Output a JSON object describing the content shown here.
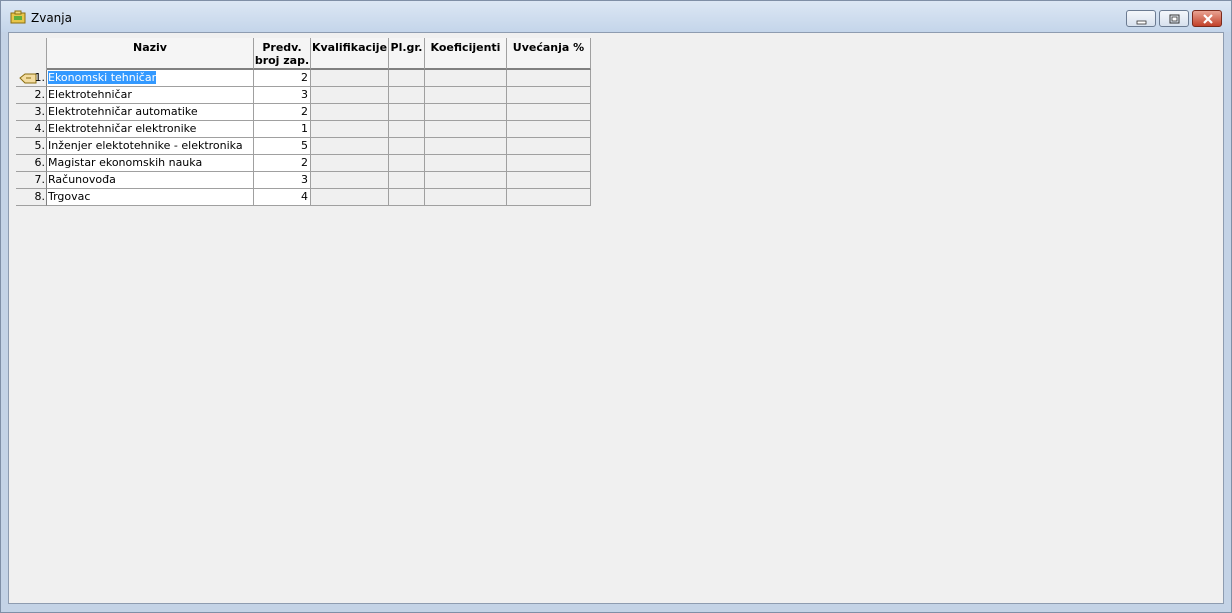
{
  "window": {
    "title": "Zvanja"
  },
  "table": {
    "columns": [
      "Naziv",
      "Predv.\nbroj zap.",
      "Kvalifikacije",
      "Pl.gr.",
      "Koeficijenti",
      "Uvećanja %"
    ],
    "rows": [
      {
        "num": "1.",
        "naziv": "Ekonomski tehničar",
        "broj": "2"
      },
      {
        "num": "2.",
        "naziv": "Elektrotehničar",
        "broj": "3"
      },
      {
        "num": "3.",
        "naziv": "Elektrotehničar automatike",
        "broj": "2"
      },
      {
        "num": "4.",
        "naziv": "Elektrotehničar elektronike",
        "broj": "1"
      },
      {
        "num": "5.",
        "naziv": "Inženjer elektotehnike - elektronika",
        "broj": "5"
      },
      {
        "num": "6.",
        "naziv": "Magistar ekonomskih nauka",
        "broj": "2"
      },
      {
        "num": "7.",
        "naziv": "Računovođa",
        "broj": "3"
      },
      {
        "num": "8.",
        "naziv": "Trgovac",
        "broj": "4"
      }
    ]
  }
}
